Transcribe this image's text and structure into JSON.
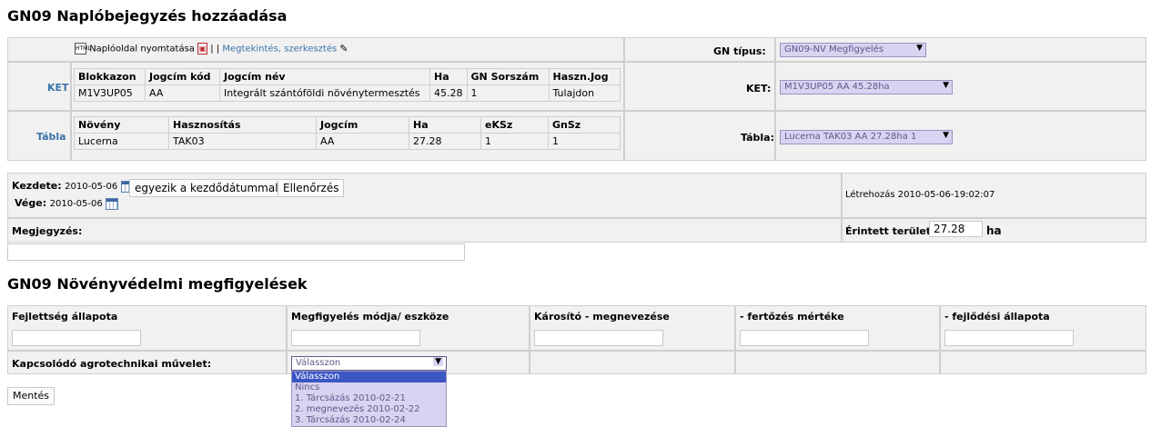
{
  "title": "GN09 Naplóbejegyzés hozzáadása",
  "toolbar": {
    "print_label": "Naplóoldal nyomtatása",
    "sep": "| |",
    "view_edit_label": "Megtekintés, szerkesztés"
  },
  "gn_tipus": {
    "label": "GN típus:",
    "value": "GN09-NV Megfigyelés"
  },
  "ket": {
    "side_label": "KET",
    "label": "KET:",
    "value": "M1V3UP05 AA 45.28ha",
    "headers": [
      "Blokkazon",
      "Jogcím kód",
      "Jogcím név",
      "Ha",
      "GN Sorszám",
      "Haszn.Jog"
    ],
    "row": [
      "M1V3UP05",
      "AA",
      "Integrált szántóföldi növénytermesztés",
      "45.28",
      "1",
      "Tulajdon"
    ]
  },
  "tabla": {
    "side_label": "Tábla",
    "label": "Tábla:",
    "value": "Lucerna TAK03 AA 27.28ha 1",
    "headers": [
      "Növény",
      "Hasznosítás",
      "Jogcím",
      "Ha",
      "eKSz",
      "GnSz"
    ],
    "row": [
      "Lucerna",
      "TAK03",
      "AA",
      "27.28",
      "1",
      "1"
    ]
  },
  "dates": {
    "start_label": "Kezdete:",
    "start_value": "2010-05-06",
    "same_btn": "egyezik a kezdődátummal",
    "check_btn": "Ellenőrzés",
    "end_label": "Vége:",
    "end_value": "2010-05-06",
    "created": "Létrehozás 2010-05-06-19:02:07"
  },
  "megjegyzes": {
    "label": "Megjegyzés:",
    "value": ""
  },
  "terulet": {
    "label": "Érintett terület:",
    "value": "27.28",
    "unit": "ha"
  },
  "section2_title": "GN09 Növényvédelmi megfigyelések",
  "obs": {
    "headers": [
      "Fejlettség állapota",
      "Megfigyelés módja/ eszköze",
      "Károsító - megnevezése",
      "- fertőzés mértéke",
      "- fejlődési állapota"
    ],
    "agro_label": "Kapcsolódó agrotechnikai művelet:",
    "select_value": "Válasszon",
    "options": [
      "Válasszon",
      "Nincs",
      "1. Tárcsázás 2010-02-21",
      "2. megnevezés 2010-02-22",
      "3. Tárcsázás 2010-02-24"
    ]
  },
  "save_btn": "Mentés",
  "colors": {
    "select_bg": "#d9d3f1",
    "link": "#3a73a8",
    "panel": "#f1f1f1",
    "highlight": "#3b57c4"
  }
}
